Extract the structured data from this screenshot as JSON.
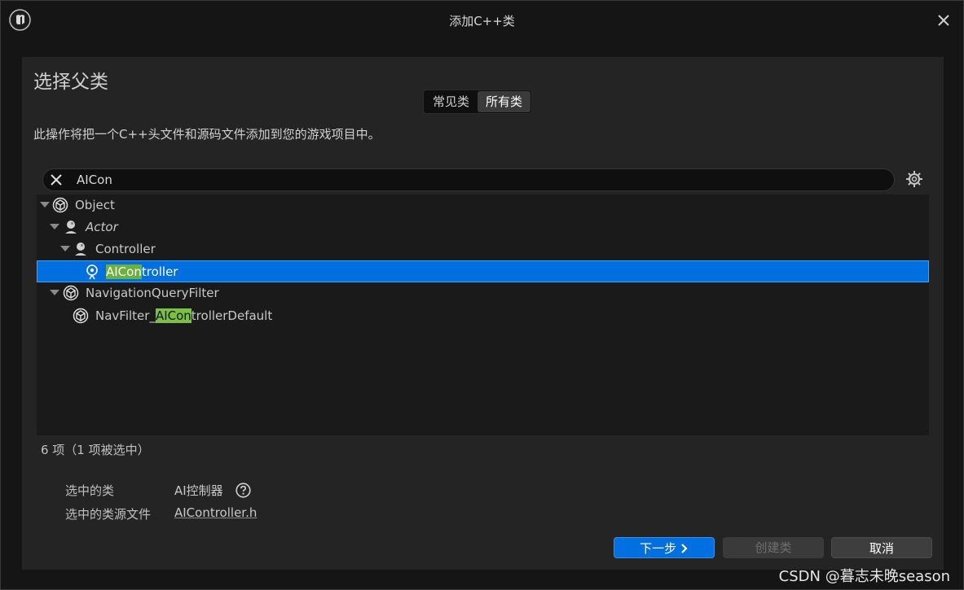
{
  "window": {
    "title": "添加C++类"
  },
  "heading": "选择父类",
  "tabs": [
    {
      "label": "常见类",
      "active": false
    },
    {
      "label": "所有类",
      "active": true
    }
  ],
  "description": "此操作将把一个C++头文件和源码文件添加到您的游戏项目中。",
  "search": {
    "value": "AICon"
  },
  "tree": [
    {
      "label": "Object",
      "icon": "object-icon",
      "expanded": true,
      "italic": false
    },
    {
      "label": "Actor",
      "icon": "actor-icon",
      "expanded": true,
      "italic": true
    },
    {
      "label": "Controller",
      "icon": "controller-icon",
      "expanded": true,
      "italic": false
    },
    {
      "label_match": "AICon",
      "label_rest": "troller",
      "icon": "ai-controller-icon",
      "selected": true
    },
    {
      "label": "NavigationQueryFilter",
      "icon": "object-icon",
      "expanded": true,
      "italic": false
    },
    {
      "label_prefix": "NavFilter_",
      "label_match": "AICon",
      "label_rest": "trollerDefault",
      "icon": "object-icon"
    }
  ],
  "count_text": "6 项（1 项被选中）",
  "info": {
    "selected_class_label": "选中的类",
    "selected_class_value": "AI控制器",
    "source_file_label": "选中的类源文件",
    "source_file_value": "AIController.h"
  },
  "buttons": {
    "next": "下一步",
    "create": "创建类",
    "cancel": "取消"
  },
  "watermark": "CSDN @暮志未晚season",
  "colors": {
    "accent": "#0070e0",
    "highlight": "#7bc043",
    "panel": "#242424",
    "background": "#151515"
  }
}
